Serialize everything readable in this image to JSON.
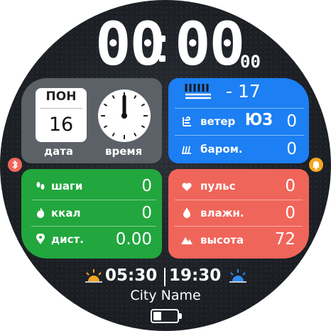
{
  "time": {
    "hours": "00",
    "minutes": "00",
    "seconds": "00"
  },
  "date": {
    "weekday": "ПОН",
    "day": "16",
    "label": "дата"
  },
  "clock": {
    "label": "время"
  },
  "weather": {
    "temperature": "- 17",
    "wind_label": "ветер",
    "wind_dir": "ЮЗ",
    "wind_value": "0",
    "baro_label": "баром.",
    "baro_value": "0"
  },
  "activity": {
    "steps_label": "шаги",
    "steps_value": "0",
    "kcal_label": "ккал",
    "kcal_value": "0",
    "dist_label": "дист.",
    "dist_value": "0.00"
  },
  "health": {
    "pulse_label": "пульс",
    "pulse_value": "0",
    "humidity_label": "влажн.",
    "humidity_value": "0",
    "altitude_label": "высота",
    "altitude_value": "72"
  },
  "sun": {
    "sunrise": "05:30",
    "sunset": "19:30"
  },
  "city": "City Name",
  "battery": {
    "level": 0.35
  },
  "colors": {
    "gray_panel": "#5c6167",
    "blue_panel": "#1c7ff3",
    "green_panel": "#22a63e",
    "red_panel": "#f0655a",
    "sun_icon": "#f5a623",
    "side_bluetooth": "#f0655a",
    "side_alarm": "#f5a623"
  },
  "icons": [
    "bluetooth-icon",
    "alarm-bell-icon",
    "weather-fog-icon",
    "wind-icon",
    "barometer-icon",
    "footsteps-icon",
    "flame-icon",
    "location-pin-icon",
    "heart-icon",
    "droplet-icon",
    "mountain-icon",
    "sunrise-icon",
    "sunset-icon",
    "battery-icon"
  ]
}
